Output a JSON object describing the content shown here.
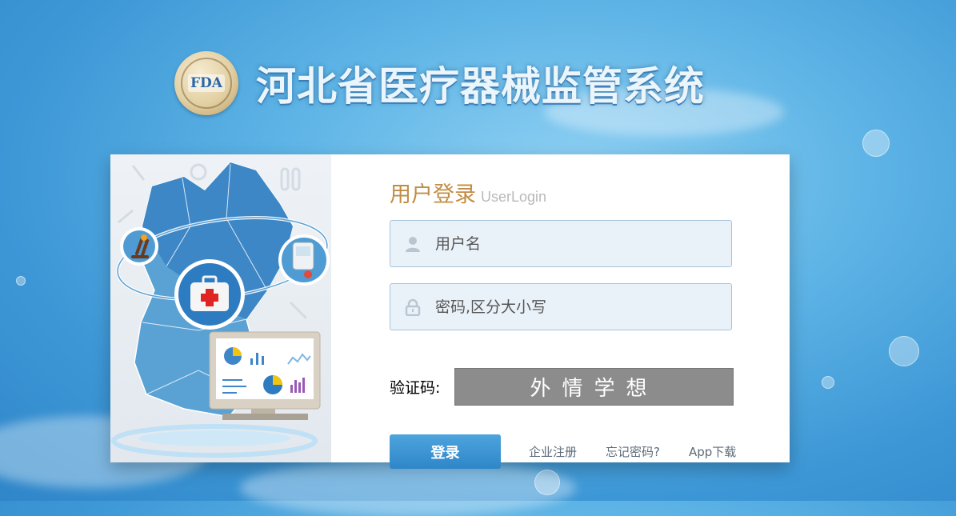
{
  "header": {
    "logo_text": "FDA",
    "title": "河北省医疗器械监管系统"
  },
  "login": {
    "title_cn": "用户登录",
    "title_en": "UserLogin",
    "username_placeholder": "用户名",
    "password_placeholder": "密码,区分大小写",
    "captcha_label": "验证码:",
    "captcha_value": "外情学想",
    "submit_label": "登录",
    "links": [
      "企业注册",
      "忘记密码?",
      "App下载"
    ]
  },
  "colors": {
    "accent": "#3a92d2",
    "title_gold": "#c08d45",
    "captcha_bg": "#8c8c8c"
  }
}
